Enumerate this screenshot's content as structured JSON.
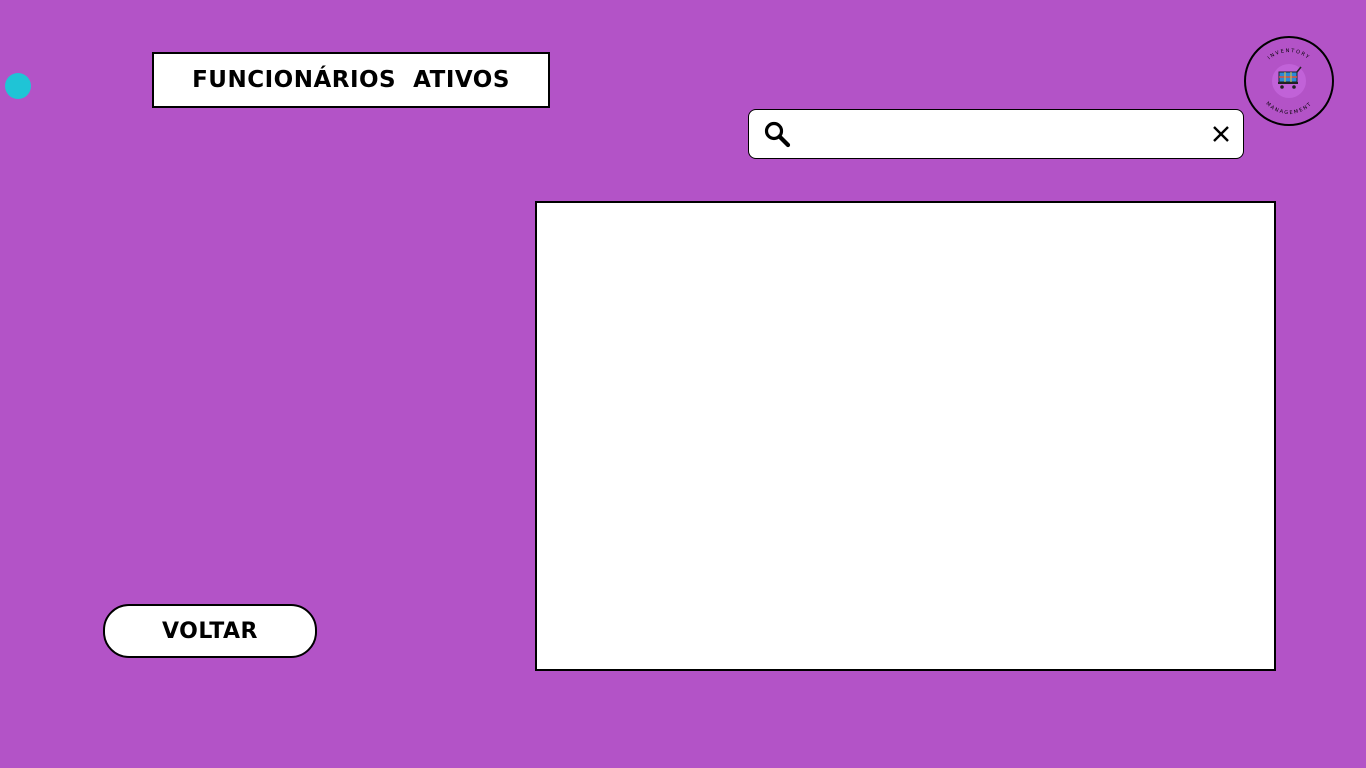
{
  "colors": {
    "background": "#b353c7",
    "accent_dot": "#1fc4d6",
    "panel": "#ffffff",
    "border": "#000000"
  },
  "header": {
    "title": "FUNCIONÁRIOS  ATIVOS"
  },
  "logo": {
    "icon": "shopping-cart-icon",
    "top_text": "INVENTORY",
    "bottom_text": "MANAGEMENT"
  },
  "search": {
    "value": "",
    "placeholder": "",
    "search_icon": "search-icon",
    "clear_icon": "close-icon"
  },
  "list": {
    "items": []
  },
  "footer": {
    "back_label": "VOLTAR"
  }
}
